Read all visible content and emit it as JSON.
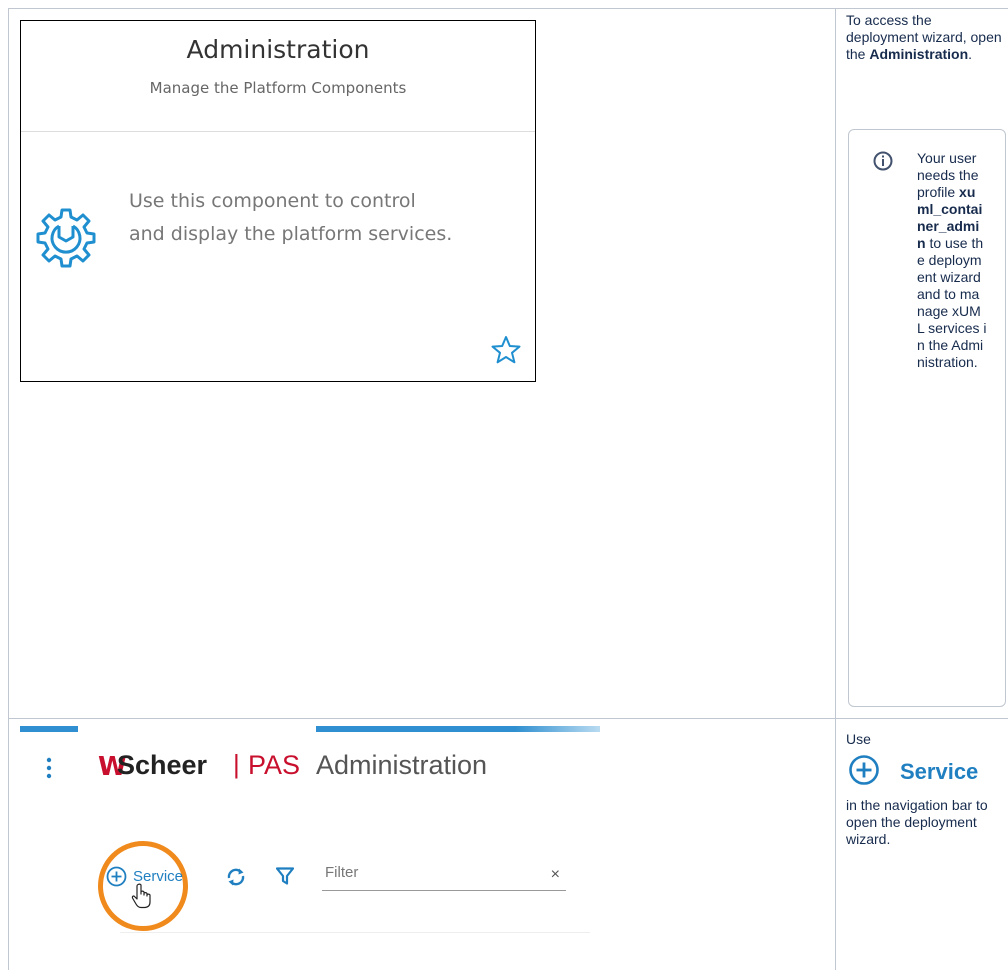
{
  "row1": {
    "screenshot": {
      "title": "Administration",
      "subtitle": "Manage the Platform Components",
      "desc_line1": "Use this component to control",
      "desc_line2": "and display the platform services.",
      "icon": "gear-wrench-icon",
      "favorite_icon": "star-outline-icon"
    },
    "text": {
      "intro_pre": "To access the deployment wizard, open the ",
      "intro_bold": "Administration",
      "intro_post": "."
    },
    "info": {
      "icon": "info-icon",
      "text_pre": "Your user needs the profile ",
      "text_bold": "xuml_container_admin",
      "text_post": " to use the deployment wizard and to manage xUML services in the Administration."
    }
  },
  "row2": {
    "screenshot": {
      "logo_mark": "W",
      "logo_brand": "Scheer",
      "logo_separator": "|",
      "logo_product": "PAS",
      "app_name": "Administration",
      "service_button": "Service",
      "filter_placeholder": "Filter",
      "filter_clear": "×"
    },
    "text": {
      "use": "Use",
      "service_label": "Service",
      "after": "in the navigation bar to open the deployment wizard."
    }
  },
  "colors": {
    "accent_blue": "#1f7fc0",
    "brand_red": "#c8102e",
    "highlight_orange": "#f08a1c",
    "border": "#c1c7d0"
  }
}
